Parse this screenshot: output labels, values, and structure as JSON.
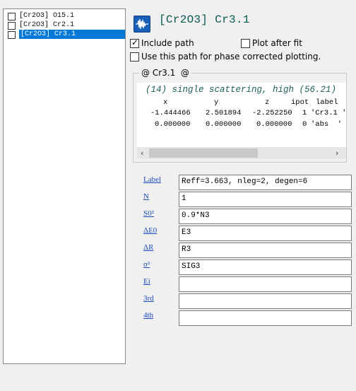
{
  "path_list": [
    {
      "label": "[Cr2O3] O15.1",
      "checked": false,
      "selected": false
    },
    {
      "label": "[Cr2O3] Cr2.1",
      "checked": false,
      "selected": false
    },
    {
      "label": "[Cr2O3] Cr3.1",
      "checked": false,
      "selected": true
    }
  ],
  "header": {
    "icon": "waveform-icon",
    "title": "[Cr2O3] Cr3.1"
  },
  "options": {
    "include_path": {
      "label": "Include path",
      "checked": true
    },
    "plot_after_fit": {
      "label": "Plot after fit",
      "checked": false
    },
    "phase_corrected": {
      "label": "Use this path for phase corrected plotting.",
      "checked": false
    }
  },
  "feff_group": {
    "caption": "@ Cr3.1  @",
    "header_line": "(14) single scattering, high (56.21)",
    "columns": [
      "x",
      "y",
      "z",
      "ipot",
      "label"
    ],
    "rows": [
      {
        "x": "-1.444466",
        "y": "2.501894",
        "z": "-2.252250",
        "ipot": "1",
        "label": "'Cr3.1 '"
      },
      {
        "x": "0.000000",
        "y": "0.000000",
        "z": "0.000000",
        "ipot": "0",
        "label": "'abs  '"
      }
    ]
  },
  "params": [
    {
      "label": "Label",
      "value": "Reff=3.663, nleg=2, degen=6"
    },
    {
      "label": "N",
      "value": "1"
    },
    {
      "label": "S0²",
      "value": "0.9*N3"
    },
    {
      "label": "ΔE0",
      "value": "E3"
    },
    {
      "label": "ΔR",
      "value": "R3"
    },
    {
      "label": "σ²",
      "value": "SIG3"
    },
    {
      "label": "Ei",
      "value": ""
    },
    {
      "label": "3rd",
      "value": ""
    },
    {
      "label": "4th",
      "value": ""
    }
  ],
  "colors": {
    "title": "#0b5a52",
    "feff_header": "#1d5c57",
    "param_label": "#1a4db8",
    "selection": "#0078d7"
  }
}
